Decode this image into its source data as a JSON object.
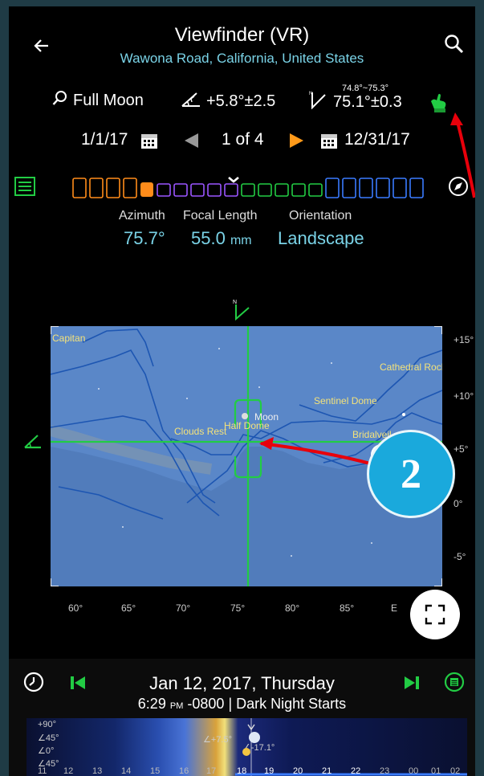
{
  "header": {
    "title": "Viewfinder (VR)",
    "subtitle": "Wawona Road, California, United States"
  },
  "info": {
    "target": "Full Moon",
    "elevation": "+5.8°±2.5",
    "azimuth": "75.1°±0.3",
    "azimuth_range": "74.8°~75.3°"
  },
  "dates": {
    "start": "1/1/17",
    "page": "1 of 4",
    "end": "12/31/17"
  },
  "metrics": {
    "azimuth_label": "Azimuth",
    "azimuth_value": "75.7°",
    "focal_label": "Focal Length",
    "focal_value": "55.0",
    "focal_unit": "mm",
    "orientation_label": "Orientation",
    "orientation_value": "Landscape"
  },
  "scene": {
    "labels": {
      "el_capitan": "Capitan",
      "cathedral_rocks": "Cathedral Rocks",
      "sentinel_dome": "Sentinel Dome",
      "moon": "Moon",
      "half_dome": "Half Dome",
      "clouds_rest": "Clouds Rest",
      "bridalveil": "Bridalveil"
    },
    "elevation_ticks": [
      "+15°",
      "+10°",
      "+5°",
      "0°",
      "-5°"
    ],
    "azimuth_ticks": [
      "60°",
      "65°",
      "70°",
      "75°",
      "80°",
      "85°",
      "E"
    ]
  },
  "badge": {
    "number": "2"
  },
  "bottom": {
    "date": "Jan 12, 2017, Thursday",
    "time": "6:29",
    "ampm": "PM",
    "tz": "-0800",
    "event": "Dark Night Starts",
    "hours": [
      "11",
      "12",
      "13",
      "14",
      "15",
      "16",
      "17",
      "18",
      "19",
      "20",
      "21",
      "22",
      "23",
      "00",
      "01",
      "02"
    ],
    "sun_elev": "∠+7.5°",
    "moon_elev": "∠-17.1°",
    "angle_marks": [
      "+90°",
      "∠45°",
      "∠0°",
      "∠45°"
    ]
  },
  "colors": {
    "accent_cyan": "#7ad3e7",
    "accent_green": "#22cc44",
    "accent_orange": "#ff8c1a",
    "sky_blue": "#5a87c8",
    "arrow_red": "#e8000b",
    "badge_blue": "#1aa9dc"
  }
}
